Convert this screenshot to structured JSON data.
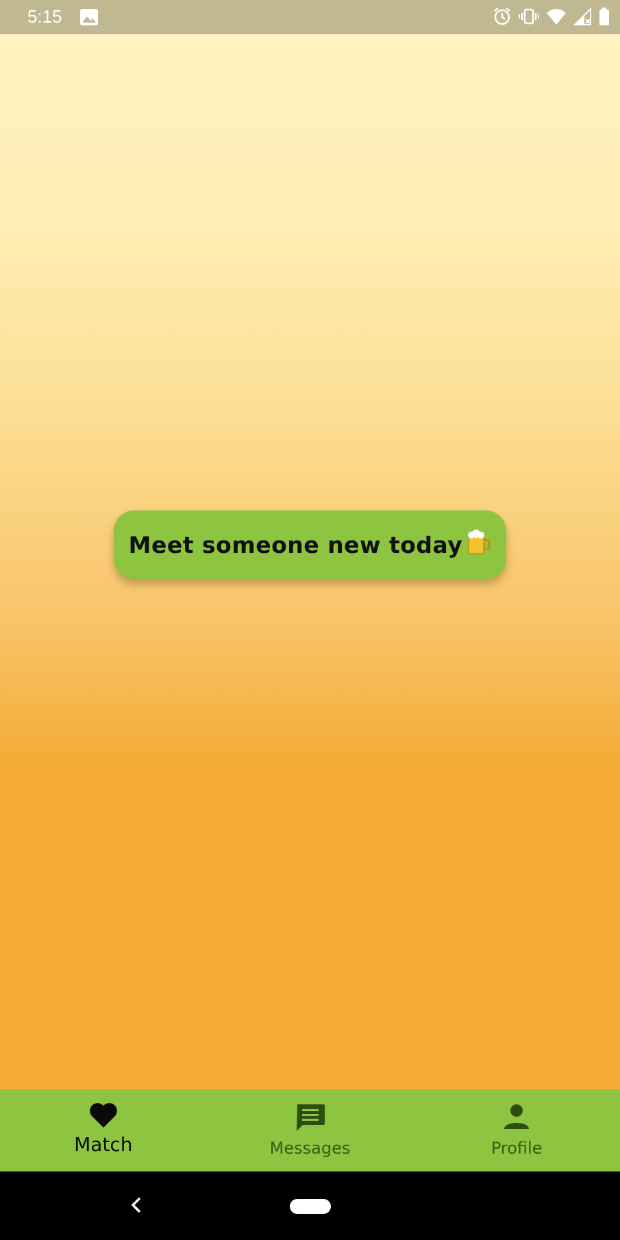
{
  "status_bar": {
    "time": "5:15",
    "icons": [
      "gallery-icon",
      "alarm-icon",
      "vibrate-icon",
      "wifi-icon",
      "signal-icon",
      "battery-icon"
    ]
  },
  "main": {
    "cta_label": "Meet someone new today",
    "cta_emoji": "🍺"
  },
  "bottom_nav": {
    "items": [
      {
        "label": "Match",
        "icon": "heart-icon",
        "active": true
      },
      {
        "label": "Messages",
        "icon": "message-icon",
        "active": false
      },
      {
        "label": "Profile",
        "icon": "person-icon",
        "active": false
      }
    ]
  },
  "colors": {
    "accent_green": "#8dc541",
    "gradient_top": "#fff3bf",
    "gradient_bottom": "#f4aa34"
  }
}
